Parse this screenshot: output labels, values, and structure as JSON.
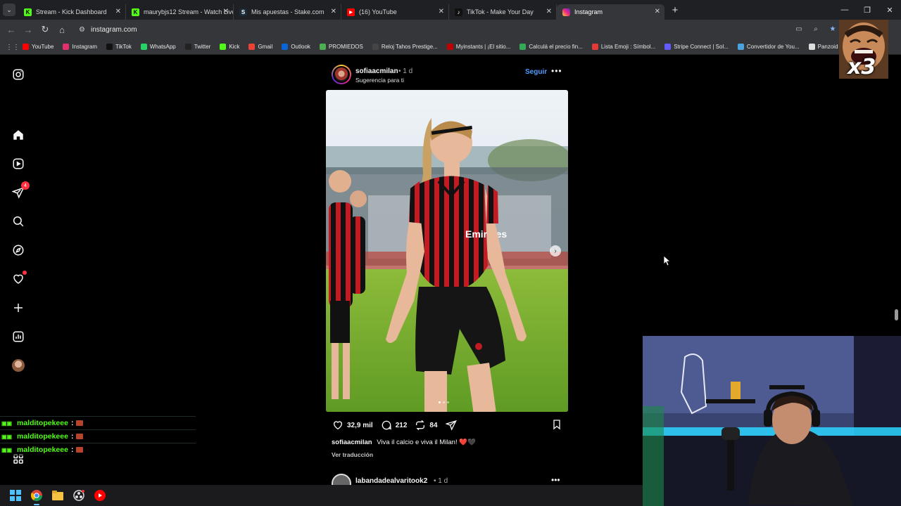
{
  "browser": {
    "tabs": [
      {
        "title": "Stream - Kick Dashboard",
        "favicon": "kick-icon",
        "color": "#53fc18",
        "active": false
      },
      {
        "title": "maurybjs12 Stream - Watch Live",
        "favicon": "kick-icon",
        "color": "#53fc18",
        "active": false
      },
      {
        "title": "Mis apuestas - Stake.com",
        "favicon": "stake-icon",
        "color": "#1a2c38",
        "active": false
      },
      {
        "title": "(16) YouTube",
        "favicon": "youtube-icon",
        "color": "#ff0000",
        "active": false
      },
      {
        "title": "TikTok - Make Your Day",
        "favicon": "tiktok-icon",
        "color": "#000000",
        "active": false
      },
      {
        "title": "Instagram",
        "favicon": "instagram-icon",
        "color": "#e1306c",
        "active": true
      }
    ],
    "url": "instagram.com",
    "bookmarks": [
      {
        "label": "YouTube",
        "color": "#ff0000"
      },
      {
        "label": "Instagram",
        "color": "#e1306c"
      },
      {
        "label": "TikTok",
        "color": "#111111"
      },
      {
        "label": "WhatsApp",
        "color": "#25d366"
      },
      {
        "label": "Twitter",
        "color": "#222222"
      },
      {
        "label": "Kick",
        "color": "#53fc18"
      },
      {
        "label": "Gmail",
        "color": "#ea4335"
      },
      {
        "label": "Outlook",
        "color": "#0a64d6"
      },
      {
        "label": "PROMIEDOS",
        "color": "#4caf50"
      },
      {
        "label": "Reloj Tahos Prestige...",
        "color": "#444444"
      },
      {
        "label": "Myinstants | ¡El sitio...",
        "color": "#c00000"
      },
      {
        "label": "Calculá el precio fin...",
        "color": "#33aa55"
      },
      {
        "label": "Lista Emoji : Símbol...",
        "color": "#e53935"
      },
      {
        "label": "Stripe Connect | Sol...",
        "color": "#635bff"
      },
      {
        "label": "Convertidor de You...",
        "color": "#4aa3df"
      },
      {
        "label": "Panzoid",
        "color": "#dddddd"
      }
    ]
  },
  "sidebar": {
    "messages_badge": "4"
  },
  "post": {
    "username": "sofiaacmilan",
    "time": "• 1 d",
    "suggestion": "Sugerencia para ti",
    "follow_label": "Seguir",
    "more_label": "•••",
    "likes": "32,9 mil",
    "comments": "212",
    "reposts": "84",
    "caption_user": "sofiaacmilan",
    "caption_text": "Viva il calcio e viva il Milan! ❤️🖤",
    "translate_label": "Ver traducción",
    "photo_text": "Emirates Fly Better"
  },
  "next_post": {
    "username": "labandadealvaritook2",
    "time": "• 1 d"
  },
  "chat": [
    {
      "user": "malditopekeee",
      "sep": ":"
    },
    {
      "user": "malditopekeee",
      "sep": ":"
    },
    {
      "user": "malditopekeee",
      "sep": ":"
    }
  ],
  "overlay": {
    "multiplier": "x3"
  },
  "colors": {
    "instagram_blue": "#4e9dff",
    "notification_red": "#ff3040",
    "kick_green": "#53fc18",
    "milan_red": "#d0202a"
  }
}
